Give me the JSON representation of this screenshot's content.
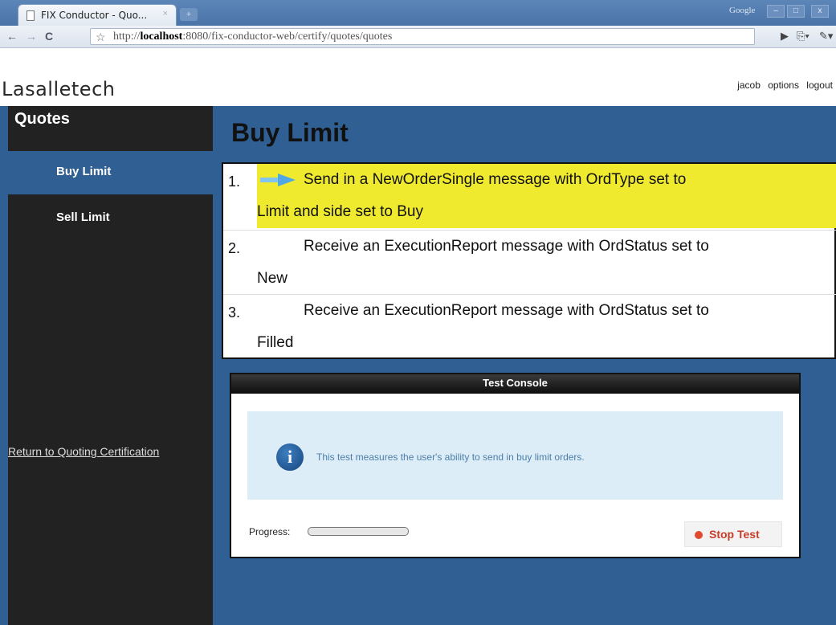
{
  "browser": {
    "tab_title": "FIX Conductor - Quo...",
    "tab_close": "×",
    "new_tab": "+",
    "google_label": "Google",
    "window_buttons": [
      "–",
      "□",
      "x"
    ],
    "url_prefix": "http://",
    "url_host": "localhost",
    "url_rest": ":8080/fix-conductor-web/certify/quotes/quotes"
  },
  "header": {
    "logo": "Lasalletech",
    "links": [
      "jacob",
      "options",
      "logout"
    ]
  },
  "sidebar": {
    "title": "Quotes",
    "items": [
      {
        "label": "Buy Limit",
        "active": true
      },
      {
        "label": "Sell Limit",
        "active": false
      }
    ],
    "return_link": "Return to Quoting Certification"
  },
  "main": {
    "title": "Buy Limit",
    "steps": [
      {
        "num": "1.",
        "line1": "Send in a NewOrderSingle message with OrdType set to",
        "line2": "Limit and side set to Buy"
      },
      {
        "num": "2.",
        "line1": "Receive an ExecutionReport message with OrdStatus set to",
        "line2": "New"
      },
      {
        "num": "3.",
        "line1": "Receive an ExecutionReport message with OrdStatus set to",
        "line2": "Filled"
      }
    ],
    "highlight_color": "#f0ea2e"
  },
  "console": {
    "title": "Test Console",
    "info": "This test measures the user's ability to send in buy limit orders.",
    "progress_label": "Progress:",
    "progress_value": 0,
    "stop_label": "Stop Test"
  }
}
